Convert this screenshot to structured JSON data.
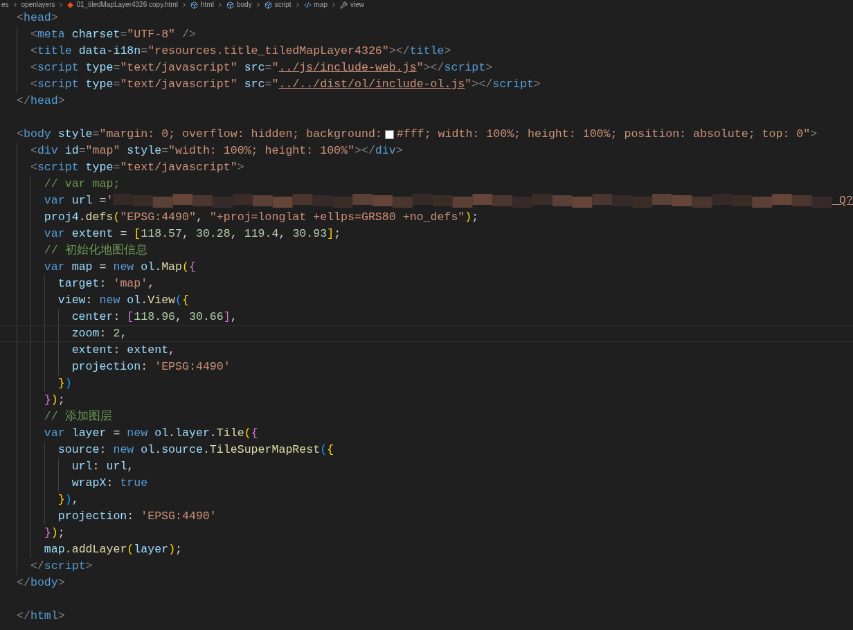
{
  "breadcrumb": [
    {
      "label": "es",
      "kind": "folder"
    },
    {
      "label": "openlayers",
      "kind": "folder"
    },
    {
      "label": "01_tiledMapLayer4326 copy.html",
      "kind": "file"
    },
    {
      "label": "html",
      "kind": "symbol"
    },
    {
      "label": "body",
      "kind": "symbol"
    },
    {
      "label": "script",
      "kind": "symbol"
    },
    {
      "label": "map",
      "kind": "variable"
    },
    {
      "label": "view",
      "kind": "property"
    }
  ],
  "lines": [
    {
      "current": false,
      "tokens": [
        {
          "kind": "p",
          "text": "<"
        },
        {
          "kind": "tag",
          "text": "head"
        },
        {
          "kind": "p",
          "text": ">"
        }
      ]
    },
    {
      "current": false,
      "tokens": [
        {
          "kind": "p",
          "text": "  <"
        },
        {
          "kind": "tag",
          "text": "meta"
        },
        {
          "kind": "attr",
          "text": " charset"
        },
        {
          "kind": "p",
          "text": "="
        },
        {
          "kind": "str",
          "text": "\"UTF-8\""
        },
        {
          "kind": "p",
          "text": " />"
        }
      ]
    },
    {
      "current": false,
      "tokens": [
        {
          "kind": "p",
          "text": "  <"
        },
        {
          "kind": "tag",
          "text": "title"
        },
        {
          "kind": "attr",
          "text": " data-i18n"
        },
        {
          "kind": "p",
          "text": "="
        },
        {
          "kind": "str",
          "text": "\"resources.title_tiledMapLayer4326\""
        },
        {
          "kind": "p",
          "text": "></"
        },
        {
          "kind": "tag",
          "text": "title"
        },
        {
          "kind": "p",
          "text": ">"
        }
      ]
    },
    {
      "current": false,
      "tokens": [
        {
          "kind": "p",
          "text": "  <"
        },
        {
          "kind": "tag",
          "text": "script"
        },
        {
          "kind": "attr",
          "text": " type"
        },
        {
          "kind": "p",
          "text": "="
        },
        {
          "kind": "str",
          "text": "\"text/javascript\""
        },
        {
          "kind": "attr",
          "text": " src"
        },
        {
          "kind": "p",
          "text": "="
        },
        {
          "kind": "str",
          "text": "\""
        },
        {
          "kind": "link",
          "text": "../js/include-web.js"
        },
        {
          "kind": "str",
          "text": "\""
        },
        {
          "kind": "p",
          "text": "></"
        },
        {
          "kind": "tag",
          "text": "script"
        },
        {
          "kind": "p",
          "text": ">"
        }
      ]
    },
    {
      "current": false,
      "tokens": [
        {
          "kind": "p",
          "text": "  <"
        },
        {
          "kind": "tag",
          "text": "script"
        },
        {
          "kind": "attr",
          "text": " type"
        },
        {
          "kind": "p",
          "text": "="
        },
        {
          "kind": "str",
          "text": "\"text/javascript\""
        },
        {
          "kind": "attr",
          "text": " src"
        },
        {
          "kind": "p",
          "text": "="
        },
        {
          "kind": "str",
          "text": "\""
        },
        {
          "kind": "link",
          "text": "../../dist/ol/include-ol.js"
        },
        {
          "kind": "str",
          "text": "\""
        },
        {
          "kind": "p",
          "text": "></"
        },
        {
          "kind": "tag",
          "text": "script"
        },
        {
          "kind": "p",
          "text": ">"
        }
      ]
    },
    {
      "current": false,
      "tokens": [
        {
          "kind": "p",
          "text": "</"
        },
        {
          "kind": "tag",
          "text": "head"
        },
        {
          "kind": "p",
          "text": ">"
        }
      ]
    },
    {
      "current": false
    },
    {
      "current": false,
      "tokens": [
        {
          "kind": "p",
          "text": "<"
        },
        {
          "kind": "tag",
          "text": "body"
        },
        {
          "kind": "attr",
          "text": " style"
        },
        {
          "kind": "p",
          "text": "="
        },
        {
          "kind": "str",
          "text": "\"margin: 0; overflow: hidden; background:"
        },
        {
          "kind": "swatch",
          "color": "#ffffff"
        },
        {
          "kind": "str",
          "text": "#fff; width: 100%; height: 100%; position: absolute; top: 0\""
        },
        {
          "kind": "p",
          "text": ">"
        }
      ]
    },
    {
      "current": false,
      "tokens": [
        {
          "kind": "p",
          "text": "  <"
        },
        {
          "kind": "tag",
          "text": "div"
        },
        {
          "kind": "attr",
          "text": " id"
        },
        {
          "kind": "p",
          "text": "="
        },
        {
          "kind": "str",
          "text": "\"map\""
        },
        {
          "kind": "attr",
          "text": " style"
        },
        {
          "kind": "p",
          "text": "="
        },
        {
          "kind": "str",
          "text": "\"width: 100%; height: 100%\""
        },
        {
          "kind": "p",
          "text": "></"
        },
        {
          "kind": "tag",
          "text": "div"
        },
        {
          "kind": "p",
          "text": ">"
        }
      ]
    },
    {
      "current": false,
      "tokens": [
        {
          "kind": "p",
          "text": "  <"
        },
        {
          "kind": "tag",
          "text": "script"
        },
        {
          "kind": "attr",
          "text": " type"
        },
        {
          "kind": "p",
          "text": "="
        },
        {
          "kind": "str",
          "text": "\"text/javascript\""
        },
        {
          "kind": "p",
          "text": ">"
        }
      ]
    },
    {
      "current": false,
      "tokens": [
        {
          "kind": "cmt",
          "text": "    // var map;"
        }
      ]
    },
    {
      "current": false,
      "tokens": [
        {
          "kind": "kw",
          "text": "    var"
        },
        {
          "kind": "var",
          "text": " url"
        },
        {
          "kind": "op",
          "text": " ="
        },
        {
          "kind": "str",
          "text": "'"
        },
        {
          "kind": "blur"
        },
        {
          "kind": "link",
          "text": "_Q?"
        }
      ]
    },
    {
      "current": false,
      "tokens": [
        {
          "kind": "var",
          "text": "    proj4"
        },
        {
          "kind": "op",
          "text": "."
        },
        {
          "kind": "fn",
          "text": "defs"
        },
        {
          "kind": "b1",
          "text": "("
        },
        {
          "kind": "str",
          "text": "\"EPSG:4490\""
        },
        {
          "kind": "op",
          "text": ", "
        },
        {
          "kind": "str",
          "text": "\"+proj=longlat +ellps=GRS80 +no_defs\""
        },
        {
          "kind": "b1",
          "text": ")"
        },
        {
          "kind": "op",
          "text": ";"
        }
      ]
    },
    {
      "current": false,
      "tokens": [
        {
          "kind": "kw",
          "text": "    var"
        },
        {
          "kind": "var",
          "text": " extent"
        },
        {
          "kind": "op",
          "text": " = "
        },
        {
          "kind": "b1",
          "text": "["
        },
        {
          "kind": "num",
          "text": "118.57"
        },
        {
          "kind": "op",
          "text": ", "
        },
        {
          "kind": "num",
          "text": "30.28"
        },
        {
          "kind": "op",
          "text": ", "
        },
        {
          "kind": "num",
          "text": "119.4"
        },
        {
          "kind": "op",
          "text": ", "
        },
        {
          "kind": "num",
          "text": "30.93"
        },
        {
          "kind": "b1",
          "text": "]"
        },
        {
          "kind": "op",
          "text": ";"
        }
      ]
    },
    {
      "current": false,
      "tokens": [
        {
          "kind": "cmt",
          "text": "    // 初始化地图信息"
        }
      ]
    },
    {
      "current": false,
      "tokens": [
        {
          "kind": "kw",
          "text": "    var"
        },
        {
          "kind": "var",
          "text": " map"
        },
        {
          "kind": "op",
          "text": " = "
        },
        {
          "kind": "kw",
          "text": "new"
        },
        {
          "kind": "var",
          "text": " ol"
        },
        {
          "kind": "op",
          "text": "."
        },
        {
          "kind": "fn",
          "text": "Map"
        },
        {
          "kind": "b1",
          "text": "("
        },
        {
          "kind": "b2",
          "text": "{"
        }
      ]
    },
    {
      "current": false,
      "tokens": [
        {
          "kind": "var",
          "text": "      target"
        },
        {
          "kind": "op",
          "text": ": "
        },
        {
          "kind": "str",
          "text": "'map'"
        },
        {
          "kind": "op",
          "text": ","
        }
      ]
    },
    {
      "current": false,
      "tokens": [
        {
          "kind": "var",
          "text": "      view"
        },
        {
          "kind": "op",
          "text": ": "
        },
        {
          "kind": "kw",
          "text": "new"
        },
        {
          "kind": "var",
          "text": " ol"
        },
        {
          "kind": "op",
          "text": "."
        },
        {
          "kind": "fn",
          "text": "View"
        },
        {
          "kind": "b3",
          "text": "("
        },
        {
          "kind": "b1",
          "text": "{"
        }
      ]
    },
    {
      "current": false,
      "tokens": [
        {
          "kind": "var",
          "text": "        center"
        },
        {
          "kind": "op",
          "text": ": "
        },
        {
          "kind": "b2",
          "text": "["
        },
        {
          "kind": "num",
          "text": "118.96"
        },
        {
          "kind": "op",
          "text": ", "
        },
        {
          "kind": "num",
          "text": "30.66"
        },
        {
          "kind": "b2",
          "text": "]"
        },
        {
          "kind": "op",
          "text": ","
        }
      ]
    },
    {
      "current": true,
      "tokens": [
        {
          "kind": "var",
          "text": "        zoom"
        },
        {
          "kind": "op",
          "text": ": "
        },
        {
          "kind": "num",
          "text": "2"
        },
        {
          "kind": "op",
          "text": ","
        }
      ]
    },
    {
      "current": false,
      "tokens": [
        {
          "kind": "var",
          "text": "        extent"
        },
        {
          "kind": "op",
          "text": ": "
        },
        {
          "kind": "var",
          "text": "extent"
        },
        {
          "kind": "op",
          "text": ","
        }
      ]
    },
    {
      "current": false,
      "tokens": [
        {
          "kind": "var",
          "text": "        projection"
        },
        {
          "kind": "op",
          "text": ": "
        },
        {
          "kind": "str",
          "text": "'EPSG:4490'"
        }
      ]
    },
    {
      "current": false,
      "tokens": [
        {
          "kind": "b1",
          "text": "      }"
        },
        {
          "kind": "b3",
          "text": ")"
        }
      ]
    },
    {
      "current": false,
      "tokens": [
        {
          "kind": "b2",
          "text": "    }"
        },
        {
          "kind": "b1",
          "text": ")"
        },
        {
          "kind": "op",
          "text": ";"
        }
      ]
    },
    {
      "current": false,
      "tokens": [
        {
          "kind": "cmt",
          "text": "    // 添加图层"
        }
      ]
    },
    {
      "current": false,
      "tokens": [
        {
          "kind": "kw",
          "text": "    var"
        },
        {
          "kind": "var",
          "text": " layer"
        },
        {
          "kind": "op",
          "text": " = "
        },
        {
          "kind": "kw",
          "text": "new"
        },
        {
          "kind": "var",
          "text": " ol"
        },
        {
          "kind": "op",
          "text": "."
        },
        {
          "kind": "var",
          "text": "layer"
        },
        {
          "kind": "op",
          "text": "."
        },
        {
          "kind": "fn",
          "text": "Tile"
        },
        {
          "kind": "b1",
          "text": "("
        },
        {
          "kind": "b2",
          "text": "{"
        }
      ]
    },
    {
      "current": false,
      "tokens": [
        {
          "kind": "var",
          "text": "      source"
        },
        {
          "kind": "op",
          "text": ": "
        },
        {
          "kind": "kw",
          "text": "new"
        },
        {
          "kind": "var",
          "text": " ol"
        },
        {
          "kind": "op",
          "text": "."
        },
        {
          "kind": "var",
          "text": "source"
        },
        {
          "kind": "op",
          "text": "."
        },
        {
          "kind": "fn",
          "text": "TileSuperMapRest"
        },
        {
          "kind": "b3",
          "text": "("
        },
        {
          "kind": "b1",
          "text": "{"
        }
      ]
    },
    {
      "current": false,
      "tokens": [
        {
          "kind": "var",
          "text": "        url"
        },
        {
          "kind": "op",
          "text": ": "
        },
        {
          "kind": "var",
          "text": "url"
        },
        {
          "kind": "op",
          "text": ","
        }
      ]
    },
    {
      "current": false,
      "tokens": [
        {
          "kind": "var",
          "text": "        wrapX"
        },
        {
          "kind": "op",
          "text": ": "
        },
        {
          "kind": "kw",
          "text": "true"
        }
      ]
    },
    {
      "current": false,
      "tokens": [
        {
          "kind": "b1",
          "text": "      }"
        },
        {
          "kind": "b3",
          "text": ")"
        },
        {
          "kind": "op",
          "text": ","
        }
      ]
    },
    {
      "current": false,
      "tokens": [
        {
          "kind": "var",
          "text": "      projection"
        },
        {
          "kind": "op",
          "text": ": "
        },
        {
          "kind": "str",
          "text": "'EPSG:4490'"
        }
      ]
    },
    {
      "current": false,
      "tokens": [
        {
          "kind": "b2",
          "text": "    }"
        },
        {
          "kind": "b1",
          "text": ")"
        },
        {
          "kind": "op",
          "text": ";"
        }
      ]
    },
    {
      "current": false,
      "tokens": [
        {
          "kind": "var",
          "text": "    map"
        },
        {
          "kind": "op",
          "text": "."
        },
        {
          "kind": "fn",
          "text": "addLayer"
        },
        {
          "kind": "b1",
          "text": "("
        },
        {
          "kind": "var",
          "text": "layer"
        },
        {
          "kind": "b1",
          "text": ")"
        },
        {
          "kind": "op",
          "text": ";"
        }
      ]
    },
    {
      "current": false,
      "tokens": [
        {
          "kind": "p",
          "text": "  </"
        },
        {
          "kind": "tag",
          "text": "script"
        },
        {
          "kind": "p",
          "text": ">"
        }
      ]
    },
    {
      "current": false,
      "tokens": [
        {
          "kind": "p",
          "text": "</"
        },
        {
          "kind": "tag",
          "text": "body"
        },
        {
          "kind": "p",
          "text": ">"
        }
      ]
    },
    {
      "current": false
    },
    {
      "current": false,
      "tokens": [
        {
          "kind": "p",
          "text": "</"
        },
        {
          "kind": "tag",
          "text": "html"
        },
        {
          "kind": "p",
          "text": ">"
        }
      ]
    }
  ]
}
